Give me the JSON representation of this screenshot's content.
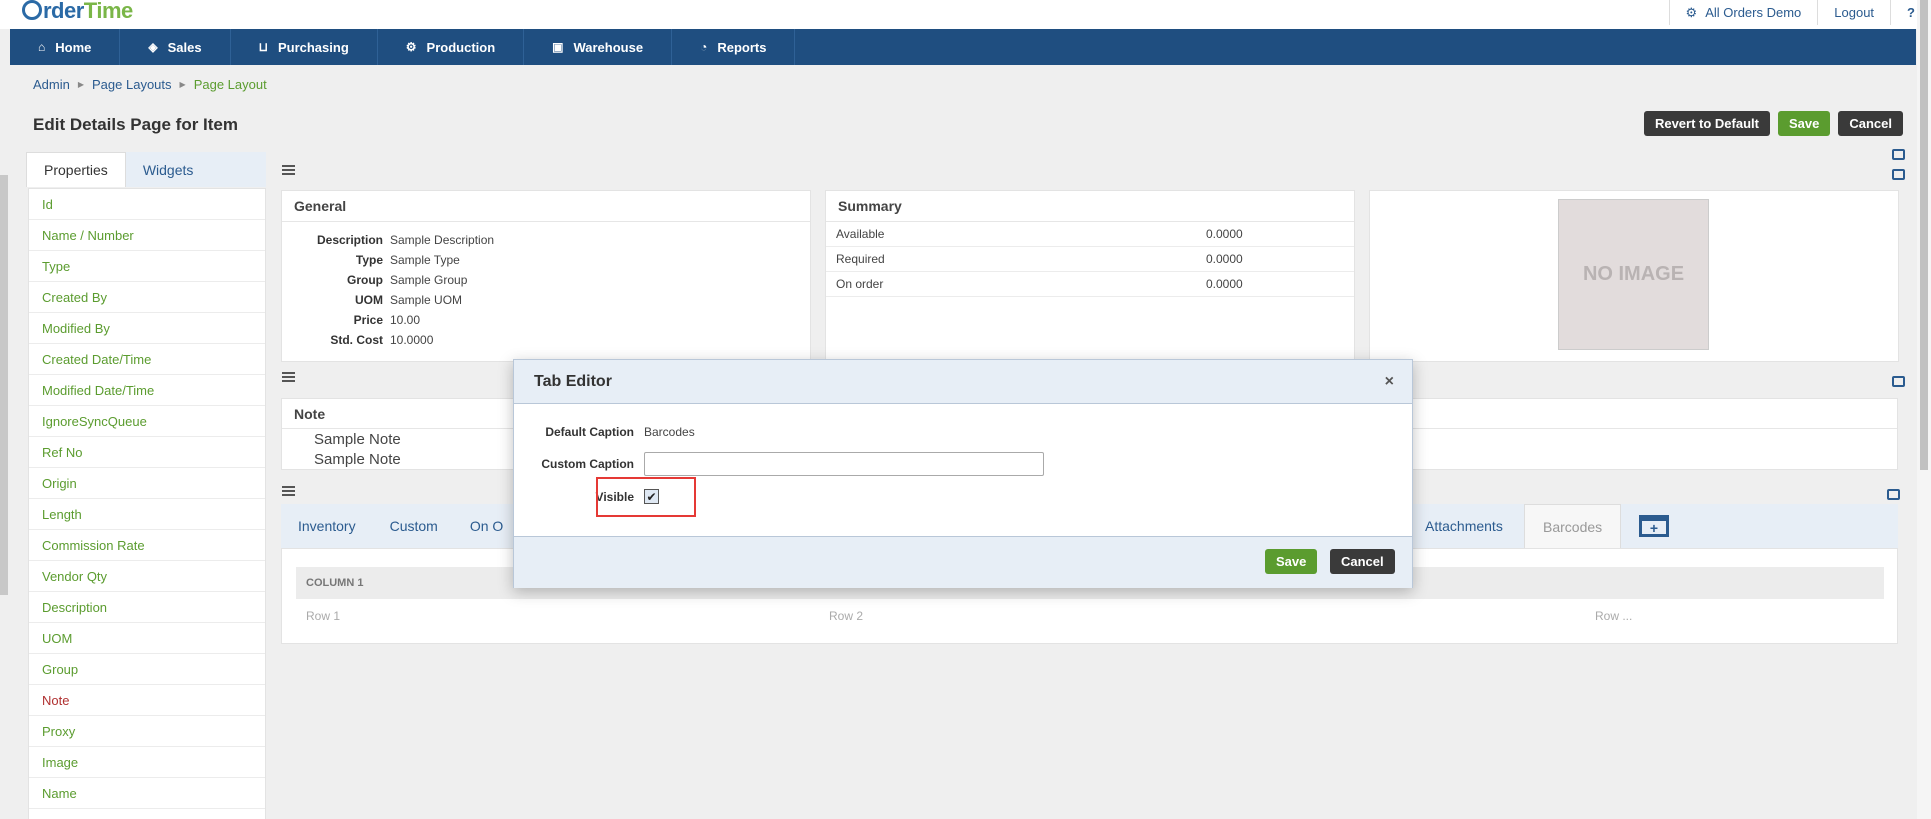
{
  "app": {
    "logo_order": "rder",
    "logo_time": "Time",
    "company": "All Orders Demo",
    "logout": "Logout",
    "help": "?"
  },
  "nav": [
    {
      "label": "Home",
      "icon": "home-icon"
    },
    {
      "label": "Sales",
      "icon": "tag-icon"
    },
    {
      "label": "Purchasing",
      "icon": "cart-icon"
    },
    {
      "label": "Production",
      "icon": "gears-icon"
    },
    {
      "label": "Warehouse",
      "icon": "box-icon"
    },
    {
      "label": "Reports",
      "icon": "pie-chart-icon"
    }
  ],
  "breadcrumb": [
    "Admin",
    "Page Layouts",
    "Page Layout"
  ],
  "page_title": "Edit Details Page for Item",
  "actions": {
    "revert": "Revert to Default",
    "save": "Save",
    "cancel": "Cancel"
  },
  "left_tabs": [
    "Properties",
    "Widgets"
  ],
  "properties": [
    {
      "label": "Id"
    },
    {
      "label": "Name / Number"
    },
    {
      "label": "Type"
    },
    {
      "label": "Created By"
    },
    {
      "label": "Modified By"
    },
    {
      "label": "Created Date/Time"
    },
    {
      "label": "Modified Date/Time"
    },
    {
      "label": "IgnoreSyncQueue"
    },
    {
      "label": "Ref No"
    },
    {
      "label": "Origin"
    },
    {
      "label": "Length"
    },
    {
      "label": "Commission Rate"
    },
    {
      "label": "Vendor Qty"
    },
    {
      "label": "Description"
    },
    {
      "label": "UOM"
    },
    {
      "label": "Group"
    },
    {
      "label": "Note",
      "color": "red"
    },
    {
      "label": "Proxy"
    },
    {
      "label": "Image"
    },
    {
      "label": "Name"
    }
  ],
  "general": {
    "title": "General",
    "rows": [
      {
        "k": "Description",
        "v": "Sample Description"
      },
      {
        "k": "Type",
        "v": "Sample Type"
      },
      {
        "k": "Group",
        "v": "Sample Group"
      },
      {
        "k": "UOM",
        "v": "Sample UOM"
      },
      {
        "k": "Price",
        "v": "10.00"
      },
      {
        "k": "Std. Cost",
        "v": "10.0000"
      }
    ]
  },
  "summary": {
    "title": "Summary",
    "rows": [
      {
        "k": "Available",
        "v": "0.0000"
      },
      {
        "k": "Required",
        "v": "0.0000"
      },
      {
        "k": "On order",
        "v": "0.0000"
      }
    ]
  },
  "no_image": "NO IMAGE",
  "note": {
    "title": "Note",
    "lines": [
      "Sample Note",
      "Sample Note"
    ]
  },
  "bottom_tabs": {
    "left": [
      "Inventory",
      "Custom",
      "On O"
    ],
    "attachments": "Attachments",
    "barcodes": "Barcodes"
  },
  "grid": {
    "column": "COLUMN 1",
    "cells": [
      "Row 1",
      "Row 2",
      "Row ..."
    ]
  },
  "modal": {
    "title": "Tab Editor",
    "close": "×",
    "default_caption_label": "Default Caption",
    "default_caption_value": "Barcodes",
    "custom_caption_label": "Custom Caption",
    "custom_caption_value": "",
    "visible_label": "Visible",
    "visible_checked": true,
    "save": "Save",
    "cancel": "Cancel"
  }
}
